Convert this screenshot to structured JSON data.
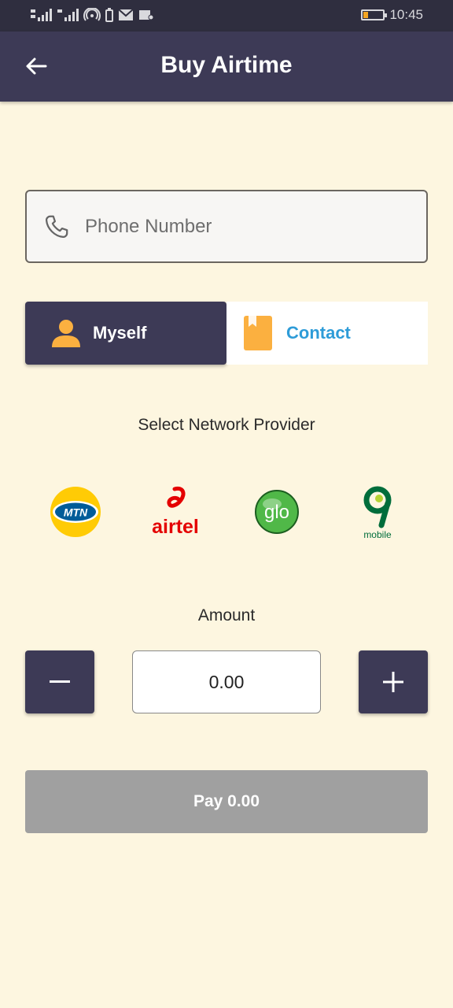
{
  "status_bar": {
    "time": "10:45",
    "colors": {
      "background": "#2f2e3f",
      "battery": "#f5a623"
    }
  },
  "app_bar": {
    "title": "Buy Airtime",
    "back_icon": "arrow-left-icon"
  },
  "phone_input": {
    "placeholder": "Phone Number",
    "value": "",
    "icon": "phone-icon"
  },
  "recipient_toggle": {
    "selected": "myself",
    "options": [
      {
        "id": "myself",
        "label": "Myself",
        "icon": "person-icon"
      },
      {
        "id": "contact",
        "label": "Contact",
        "icon": "contact-book-icon"
      }
    ]
  },
  "network": {
    "label": "Select Network Provider",
    "providers": [
      {
        "name": "MTN",
        "logo_text": "MTN"
      },
      {
        "name": "airtel",
        "logo_text": "airtel"
      },
      {
        "name": "glo",
        "logo_text": "glo"
      },
      {
        "name": "9mobile",
        "logo_text": "mobile"
      }
    ]
  },
  "amount": {
    "label": "Amount",
    "value": "0.00",
    "decrement_icon": "minus-icon",
    "increment_icon": "plus-icon"
  },
  "pay_button": {
    "label": "Pay 0.00"
  },
  "colors": {
    "background": "#fdf6e0",
    "primary": "#3d3a56",
    "accent": "#fbb040",
    "contact_text": "#2e9cd8",
    "disabled_button": "#a0a0a0"
  }
}
